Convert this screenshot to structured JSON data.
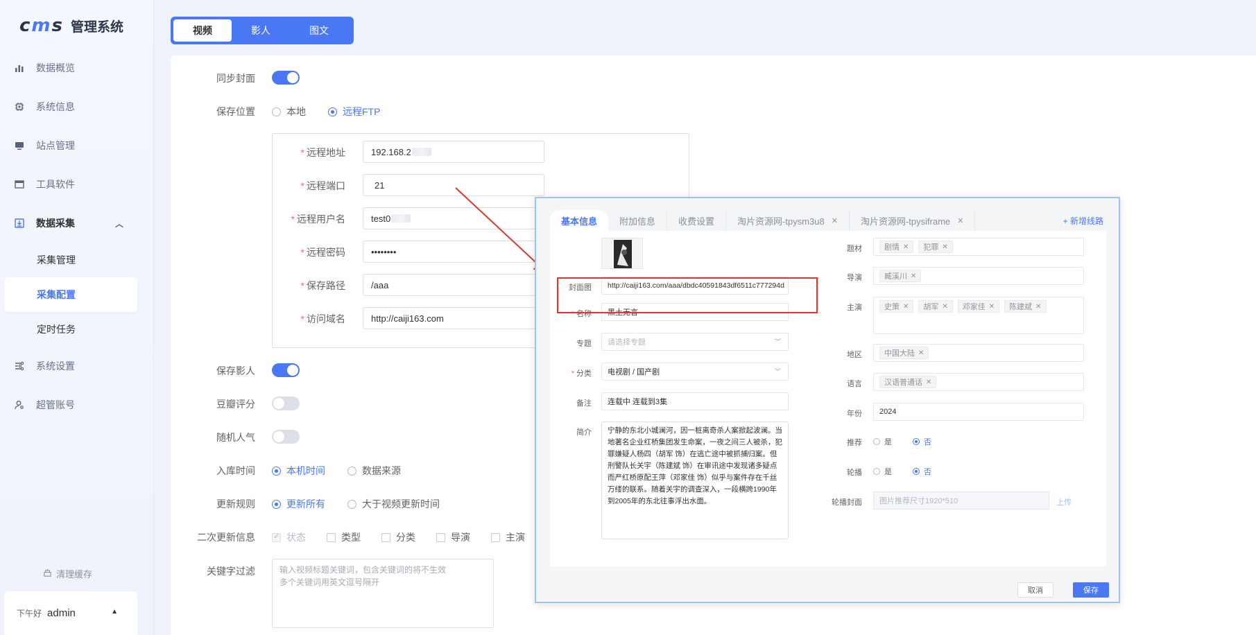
{
  "brand": {
    "logo_text": "cms",
    "system_name": "管理系统"
  },
  "sidebar": {
    "items": [
      {
        "label": "数据概览",
        "icon": "bar-chart-icon"
      },
      {
        "label": "系统信息",
        "icon": "chip-icon"
      },
      {
        "label": "站点管理",
        "icon": "monitor-icon"
      },
      {
        "label": "工具软件",
        "icon": "window-icon"
      },
      {
        "label": "数据采集",
        "icon": "download-box-icon"
      },
      {
        "label": "系统设置",
        "icon": "settings-sliders-icon"
      },
      {
        "label": "超管账号",
        "icon": "user-gear-icon"
      }
    ],
    "sub_items": [
      "采集管理",
      "采集配置",
      "定时任务"
    ],
    "clear_cache": "清理缓存",
    "greeting": "下午好",
    "username": "admin"
  },
  "tabs": [
    "视频",
    "影人",
    "图文"
  ],
  "form": {
    "sync_cover": "同步封面",
    "save_location": {
      "label": "保存位置",
      "options": [
        "本地",
        "远程FTP"
      ],
      "selected": "远程FTP"
    },
    "ftp": {
      "remote_addr": {
        "label": "远程地址",
        "value": "192.168.2"
      },
      "remote_port": {
        "label": "远程端口",
        "value": "21"
      },
      "remote_user": {
        "label": "远程用户名",
        "value": "test0"
      },
      "remote_pass": {
        "label": "远程密码",
        "value": "••••••••"
      },
      "save_path": {
        "label": "保存路径",
        "value": "/aaa"
      },
      "domain": {
        "label": "访问域名",
        "value": "http://caiji163.com"
      }
    },
    "save_actor": "保存影人",
    "douban_score": "豆瓣评分",
    "random_pop": "随机人气",
    "store_time": {
      "label": "入库时间",
      "options": [
        "本机时间",
        "数据来源"
      ],
      "selected": "本机时间"
    },
    "update_rule": {
      "label": "更新规则",
      "options": [
        "更新所有",
        "大于视频更新时间"
      ],
      "selected": "更新所有"
    },
    "second_update": {
      "label": "二次更新信息",
      "options": [
        "状态",
        "类型",
        "分类",
        "导演",
        "主演"
      ]
    },
    "keyword_filter": {
      "label": "关键字过滤",
      "placeholder": "输入视频标题关键词，包含关键词的将不生效\n多个关键词用英文逗号隔开"
    }
  },
  "dialog": {
    "tabs": [
      "基本信息",
      "附加信息",
      "收费设置",
      "淘片资源网-tpysm3u8",
      "淘片资源网-tpysiframe"
    ],
    "new_line": "+ 新增线路",
    "cover_label": "封面图",
    "cover_url": "http://caiji163.com/aaa/dbdc40591843df6511c777294d",
    "name_label": "名称",
    "name_value": "黑土无言",
    "topic_label": "专题",
    "topic_placeholder": "请选择专题",
    "category_label": "分类",
    "category_value": "电视剧 / 国产剧",
    "remark_label": "备注",
    "remark_value": "连载中 连载到3集",
    "intro_label": "简介",
    "intro_value": "宁静的东北小城澜河，因一桩离奇杀人案掀起波澜。当地著名企业红桥集团发生命案，一夜之间三人被杀，犯罪嫌疑人杨四（胡军 饰）在逃亡途中被抓捕归案。但刑警队长关宇（陈建斌 饰）在审讯途中发现诸多疑点而严红桥原配王萍（邓家佳 饰）似乎与案件存在千丝万缕的联系。随着关宇的调查深入，一段横跨1990年到2005年的东北往事浮出水面。",
    "theme_label": "题材",
    "themes": [
      "剧情",
      "犯罪"
    ],
    "director_label": "导演",
    "directors": [
      "臧溪川"
    ],
    "cast_label": "主演",
    "cast": [
      "史策",
      "胡军",
      "邓家佳",
      "陈建斌"
    ],
    "region_label": "地区",
    "regions": [
      "中国大陆"
    ],
    "language_label": "语言",
    "languages": [
      "汉语普通话"
    ],
    "year_label": "年份",
    "year_value": "2024",
    "recommend_label": "推荐",
    "carousel_label": "轮播",
    "yes": "是",
    "no": "否",
    "carousel_cover_label": "轮播封面",
    "carousel_cover_placeholder": "图片推荐尺寸1920*510",
    "upload": "上传",
    "cancel": "取消",
    "save": "保存"
  },
  "colors": {
    "accent": "#4a78f5",
    "highlight": "#e03434"
  }
}
